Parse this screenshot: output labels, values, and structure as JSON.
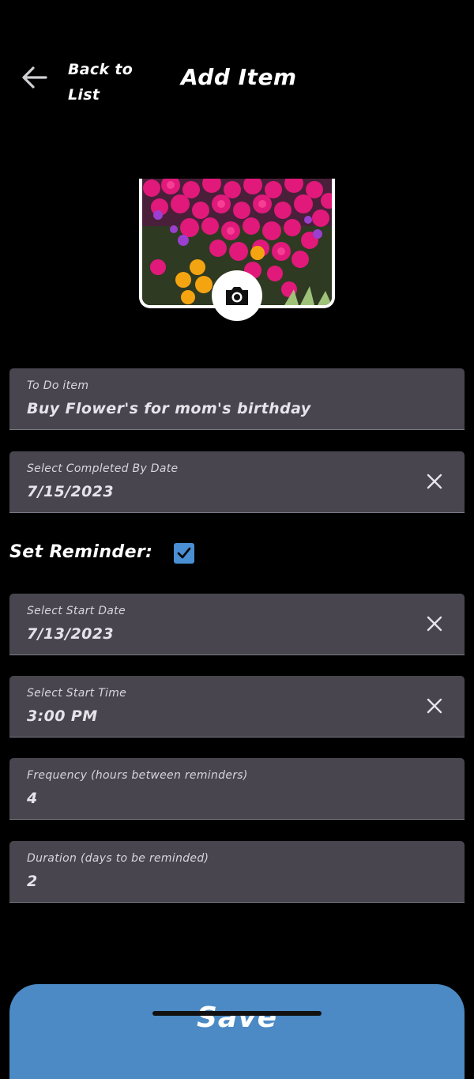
{
  "header": {
    "back_label_line1": "Back to",
    "back_label_line2": "List",
    "title": "Add Item"
  },
  "photo": {
    "description_icon": "camera-icon"
  },
  "fields": {
    "todo": {
      "label": "To Do item",
      "value": "Buy Flower's for mom's birthday"
    },
    "completed_by": {
      "label": "Select Completed By Date",
      "value": "7/15/2023"
    },
    "start_date": {
      "label": "Select Start Date",
      "value": "7/13/2023"
    },
    "start_time": {
      "label": "Select Start Time",
      "value": "3:00 PM"
    },
    "frequency": {
      "label": "Frequency (hours between reminders)",
      "value": "4"
    },
    "duration": {
      "label": "Duration (days to be reminded)",
      "value": "2"
    }
  },
  "reminder": {
    "label": "Set Reminder:",
    "checked": true
  },
  "save": {
    "label": "Save"
  },
  "colors": {
    "background": "#000000",
    "field_bg": "#48454f",
    "accent": "#4b8ac4",
    "checkbox": "#4a8fd3"
  }
}
